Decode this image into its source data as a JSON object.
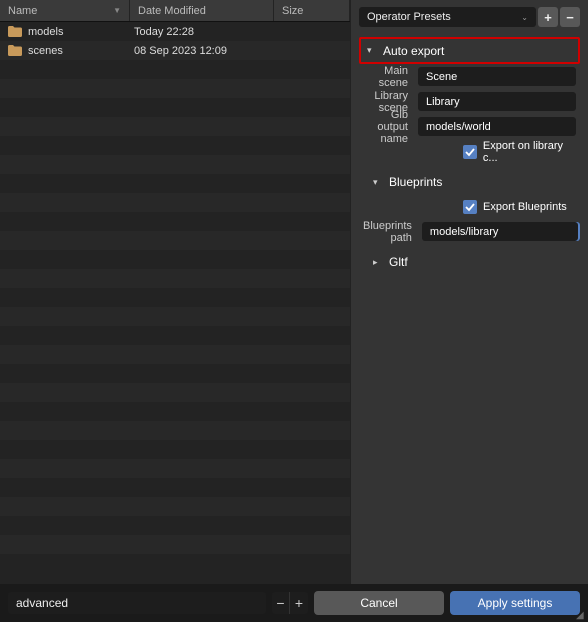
{
  "columns": {
    "name": "Name",
    "date": "Date Modified",
    "size": "Size"
  },
  "files": [
    {
      "name": "models",
      "date": "Today 22:28",
      "size": ""
    },
    {
      "name": "scenes",
      "date": "08 Sep 2023 12:09",
      "size": ""
    }
  ],
  "preset": {
    "label": "Operator Presets"
  },
  "sections": {
    "auto_export": {
      "title": "Auto export",
      "main_scene_label": "Main scene",
      "main_scene_value": "Scene",
      "library_scene_label": "Library scene",
      "library_scene_value": "Library",
      "glb_output_label": "Glb output name",
      "glb_output_value": "models/world",
      "export_library_label": "Export on library c..."
    },
    "blueprints": {
      "title": "Blueprints",
      "export_label": "Export Blueprints",
      "path_label": "Blueprints path",
      "path_value": "models/library"
    },
    "gltf": {
      "title": "Gltf"
    }
  },
  "bottom": {
    "search_value": "advanced",
    "cancel": "Cancel",
    "apply": "Apply settings"
  }
}
